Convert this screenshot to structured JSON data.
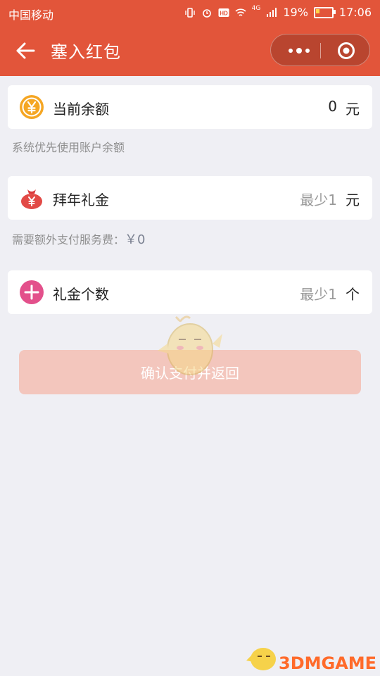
{
  "status_bar": {
    "carrier": "中国移动",
    "network": "4G",
    "battery": "19%",
    "time": "17:06"
  },
  "nav": {
    "title": "塞入红包"
  },
  "balance": {
    "label": "当前余额",
    "amount": "0",
    "unit": "元",
    "icon": "yen-coin-icon"
  },
  "balance_note": "系统优先使用账户余额",
  "gift": {
    "label": "拜年礼金",
    "hint": "最少1",
    "unit": "元",
    "icon": "money-bag-icon"
  },
  "fee_note": {
    "text": "需要额外支付服务费：",
    "value": "￥0"
  },
  "count": {
    "label": "礼金个数",
    "hint": "最少1",
    "unit": "个",
    "icon": "plus-icon"
  },
  "confirm_label": "确认支付并返回",
  "watermark": "3DMGAME",
  "colors": {
    "brand": "#e2553a",
    "button_disabled": "#f3c6bd",
    "background": "#efeff4"
  }
}
